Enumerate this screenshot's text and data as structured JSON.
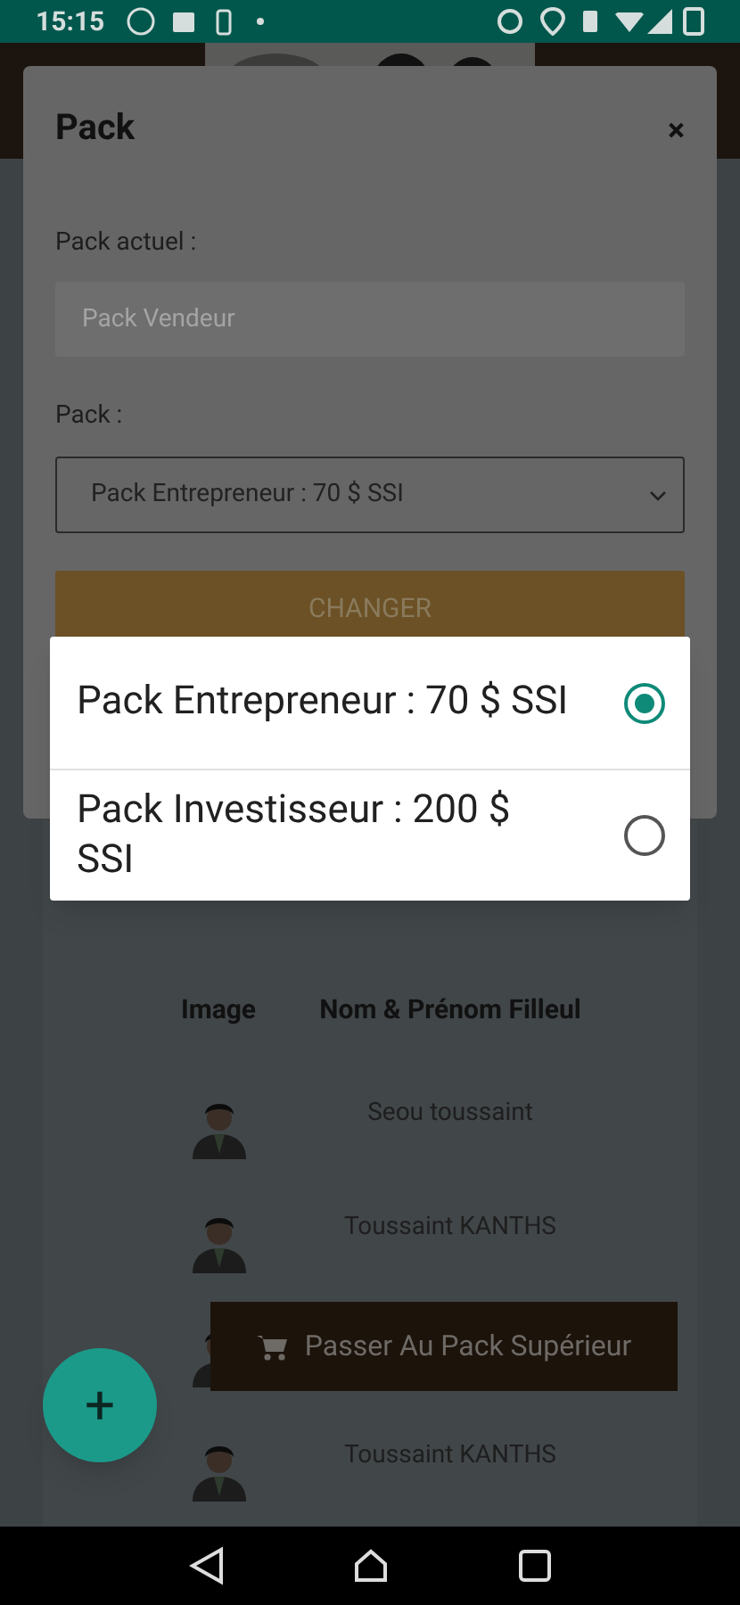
{
  "status_bar": {
    "time": "15:15"
  },
  "modal": {
    "title": "Pack",
    "close": "×",
    "current_label": "Pack actuel :",
    "current_value": "Pack Vendeur",
    "pack_label": "Pack :",
    "pack_value": "Pack Entrepreneur : 70 $ SSI",
    "button": "CHANGER"
  },
  "pack_options": [
    {
      "label": "Pack Entrepreneur : 70 $ SSI",
      "selected": true
    },
    {
      "label": "Pack Investisseur : 200 $ SSI",
      "selected": false
    }
  ],
  "table": {
    "columns": [
      "Image",
      "Nom & Prénom Filleul"
    ],
    "rows": [
      {
        "name": "Seou toussaint"
      },
      {
        "name": "Toussaint KANTHS"
      },
      {},
      {
        "name": "Toussaint KANTHS"
      }
    ]
  },
  "snackbar": {
    "label": "Passer Au Pack Supérieur"
  },
  "fab": {
    "label": "+"
  }
}
